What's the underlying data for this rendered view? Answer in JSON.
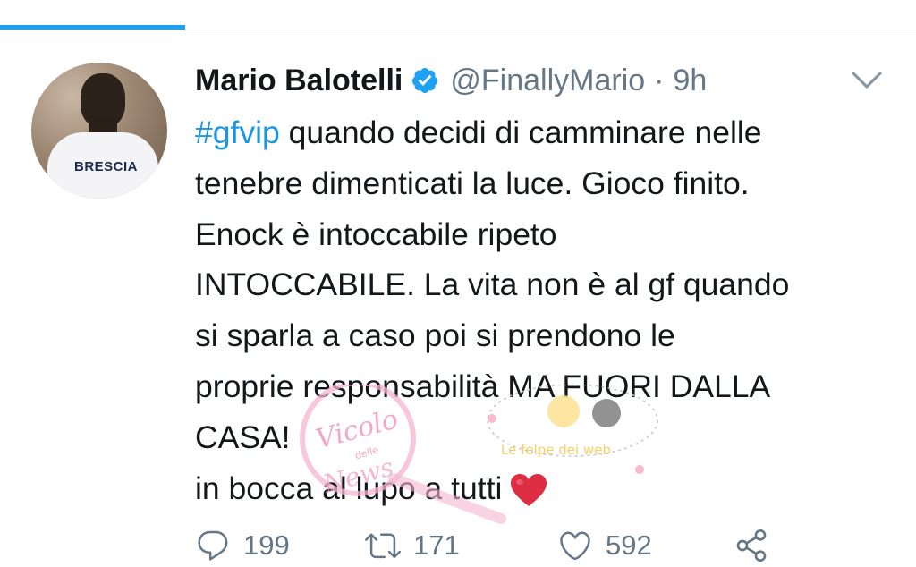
{
  "tweet": {
    "name": "Mario Balotelli",
    "handle": "@FinallyMario",
    "separator": "·",
    "time": "9h",
    "avatar_shirt_text": "BRESCIA",
    "lines": [
      {
        "hashtag": "#gfvip",
        "text": " quando decidi di camminare nelle"
      },
      {
        "text": "tenebre dimenticati la luce. Gioco finito."
      },
      {
        "text": "Enock è intoccabile ripeto"
      },
      {
        "text": "INTOCCABILE. La vita non è al gf quando"
      },
      {
        "text": "si sparla a caso poi si prendono le"
      },
      {
        "text": "proprie responsabilità MA FUORI DALLA"
      },
      {
        "text": "CASA!"
      },
      {
        "text": "in bocca al lupo a tutti"
      }
    ],
    "emoji": "red-heart-emoji"
  },
  "actions": {
    "reply_count": "199",
    "retweet_count": "171",
    "like_count": "592"
  },
  "watermark": {
    "text_main": "Vicolo",
    "text_small": "delle",
    "text_end": "News",
    "banner": "Le felpe dei web"
  },
  "colors": {
    "accent": "#1da1f2",
    "hashtag": "#1b95e0",
    "muted": "#657786",
    "verified": "#1da1f2",
    "heart": "#e0245e"
  }
}
